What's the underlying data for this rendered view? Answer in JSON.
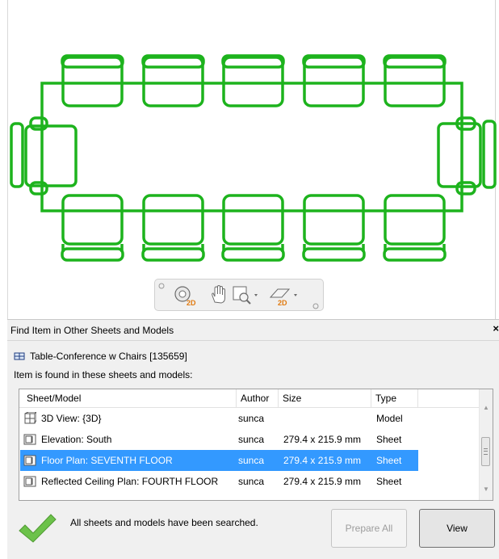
{
  "canvas": {
    "line_color": "#1db31d"
  },
  "nav_toolbar": {
    "tools": [
      {
        "icon": "steering-wheel-2d-icon",
        "badge": "2D"
      },
      {
        "icon": "pan-hand-icon"
      },
      {
        "icon": "zoom-window-icon"
      },
      {
        "icon": "section-box-2d-icon",
        "badge": "2D"
      }
    ]
  },
  "dialog": {
    "title": "Find Item in Other Sheets and Models",
    "close_label": "×",
    "element_name": "Table-Conference w Chairs [135659]",
    "found_label": "Item is found in these sheets and models:",
    "columns": {
      "sheet_model": "Sheet/Model",
      "author": "Author",
      "size": "Size",
      "type": "Type"
    },
    "rows": [
      {
        "icon": "3d-view-icon",
        "name": "3D View: {3D}",
        "author": "sunca",
        "size": "",
        "type": "Model",
        "selected": false
      },
      {
        "icon": "sheet-icon",
        "name": "Elevation: South",
        "author": "sunca",
        "size": "279.4 x 215.9 mm",
        "type": "Sheet",
        "selected": false
      },
      {
        "icon": "sheet-icon",
        "name": "Floor Plan: SEVENTH FLOOR",
        "author": "sunca",
        "size": "279.4 x 215.9 mm",
        "type": "Sheet",
        "selected": true
      },
      {
        "icon": "sheet-icon",
        "name": "Reflected Ceiling Plan: FOURTH FLOOR",
        "author": "sunca",
        "size": "279.4 x 215.9 mm",
        "type": "Sheet",
        "selected": false
      }
    ],
    "status_text": "All sheets and models have been searched.",
    "buttons": {
      "prepare_all": "Prepare All",
      "view": "View"
    },
    "selection_color": "#3399ff",
    "check_color": "#5cb135"
  }
}
